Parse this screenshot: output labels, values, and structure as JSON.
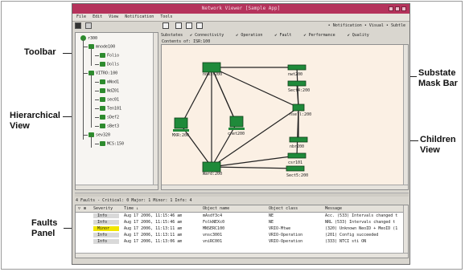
{
  "window": {
    "title": "Network Viewer [Sample App]"
  },
  "menubar": [
    "File",
    "Edit",
    "View",
    "Notification",
    "Tools"
  ],
  "callouts": {
    "toolbar": "Toolbar",
    "hierarchical": [
      "Hierarchical",
      "View"
    ],
    "faults": [
      "Faults",
      "Panel"
    ],
    "substate": [
      "Substate",
      "Mask Bar"
    ],
    "children": [
      "Children",
      "View"
    ]
  },
  "tree": [
    {
      "label": "r300",
      "depth": 0
    },
    {
      "label": "mnode100",
      "depth": 1
    },
    {
      "label": "Folio",
      "depth": 2
    },
    {
      "label": "Dolls",
      "depth": 2
    },
    {
      "label": "VITRO:100",
      "depth": 1
    },
    {
      "label": "mNod1",
      "depth": 2
    },
    {
      "label": "NdZ01",
      "depth": 2
    },
    {
      "label": "sec01",
      "depth": 2
    },
    {
      "label": "Ten101",
      "depth": 2
    },
    {
      "label": "sDef2",
      "depth": 2
    },
    {
      "label": "sBet3",
      "depth": 2
    },
    {
      "label": "sev320",
      "depth": 1
    },
    {
      "label": "MCS:150",
      "depth": 2
    }
  ],
  "view_toolbar": {
    "modes": "• Notification  • Visual  • Subtle"
  },
  "substate_bar": {
    "label": "Substates",
    "items": [
      "Connectivity",
      "Operation",
      "Fault",
      "Performance",
      "Quality"
    ]
  },
  "children_view": {
    "title": "Contents of: ISR:100",
    "nodes": [
      {
        "name": "nowir200"
      },
      {
        "name": "nwt200"
      },
      {
        "name": "Sect4:200"
      },
      {
        "name": "MXR:200"
      },
      {
        "name": "cnet200"
      },
      {
        "name": "nbr200"
      },
      {
        "name": "csr101"
      },
      {
        "name": "Sect5:200"
      },
      {
        "name": "Ward:200"
      },
      {
        "name": "nsell:200"
      }
    ]
  },
  "faults": {
    "summary": "4 Faults - Critical: 0  Major: 1  Minor: 1  Info: 4",
    "columns": [
      "Severity",
      "Time ↓",
      "Object name",
      "Object class",
      "Message"
    ],
    "rows": [
      {
        "severity": "Info",
        "color": "#d9d9d9",
        "time": "Aug 17 2006, 11:15:46 am",
        "object": "mAsdf3c4",
        "class": "NE",
        "message": "Acc. (533) Intervals changed t"
      },
      {
        "severity": "Info",
        "color": "#d9d9d9",
        "time": "Aug 17 2006, 11:15:46 am",
        "object": "FolkNEXc0",
        "class": "NE",
        "message": "NRL (533) Intervals changed t"
      },
      {
        "severity": "Minor",
        "color": "#f2e600",
        "time": "Aug 17 2006, 11:13:11 am",
        "object": "MNSERC100",
        "class": "VRIO-Mtwe",
        "message": "(320) Unknown NeoID + MeoID (1"
      },
      {
        "severity": "Info",
        "color": "#d9d9d9",
        "time": "Aug 17 2006, 11:13:11 am",
        "object": "vnsc3001",
        "class": "VRIO-Operation",
        "message": "(201) Config succeeded"
      },
      {
        "severity": "Info",
        "color": "#d9d9d9",
        "time": "Aug 17 2006, 11:13:06 am",
        "object": "vniRC001",
        "class": "VRIO-Operation",
        "message": "(333) NTCI sti ON"
      }
    ]
  }
}
